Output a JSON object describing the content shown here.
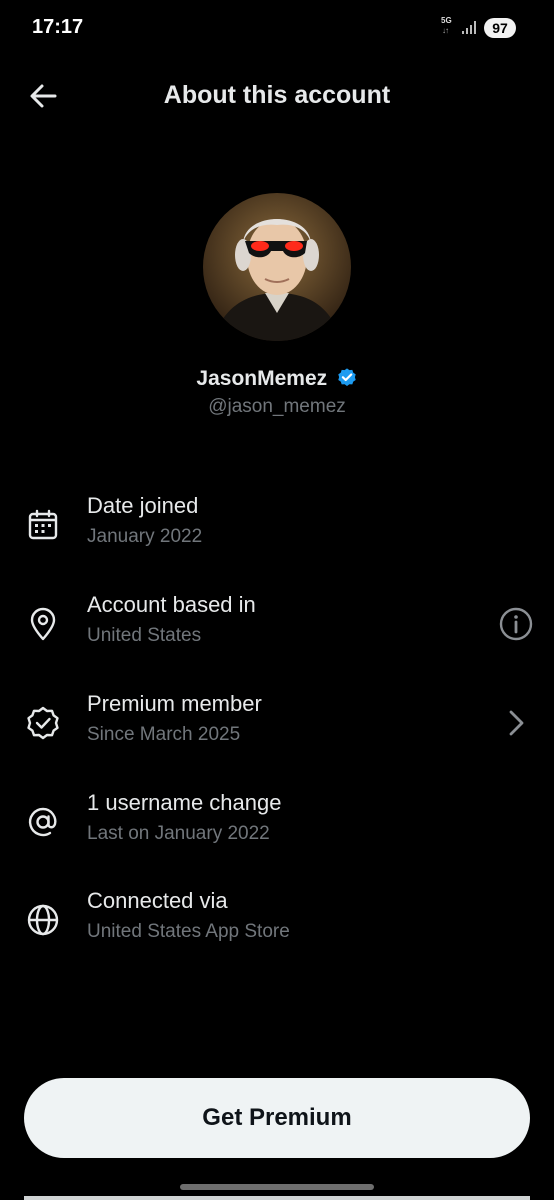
{
  "status_bar": {
    "time": "17:17",
    "network": "5G",
    "battery": "97"
  },
  "header": {
    "title": "About this account"
  },
  "profile": {
    "display_name": "JasonMemez",
    "handle": "@jason_memez",
    "verified": true,
    "verified_color": "#1d9bf0"
  },
  "rows": [
    {
      "icon": "calendar-icon",
      "title": "Date joined",
      "subtitle": "January 2022"
    },
    {
      "icon": "location-pin-icon",
      "title": "Account based in",
      "subtitle": "United States",
      "trailing": "info-icon"
    },
    {
      "icon": "verified-badge-icon",
      "title": "Premium member",
      "subtitle": "Since March 2025",
      "trailing": "chevron-right-icon"
    },
    {
      "icon": "at-sign-icon",
      "title": "1 username change",
      "subtitle": "Last on January 2022"
    },
    {
      "icon": "globe-icon",
      "title": "Connected via",
      "subtitle": "United States App Store"
    }
  ],
  "cta": {
    "label": "Get Premium"
  },
  "colors": {
    "background": "#000000",
    "text_primary": "#e7e9ea",
    "text_secondary": "#71767b",
    "cta_background": "#eff3f4"
  }
}
